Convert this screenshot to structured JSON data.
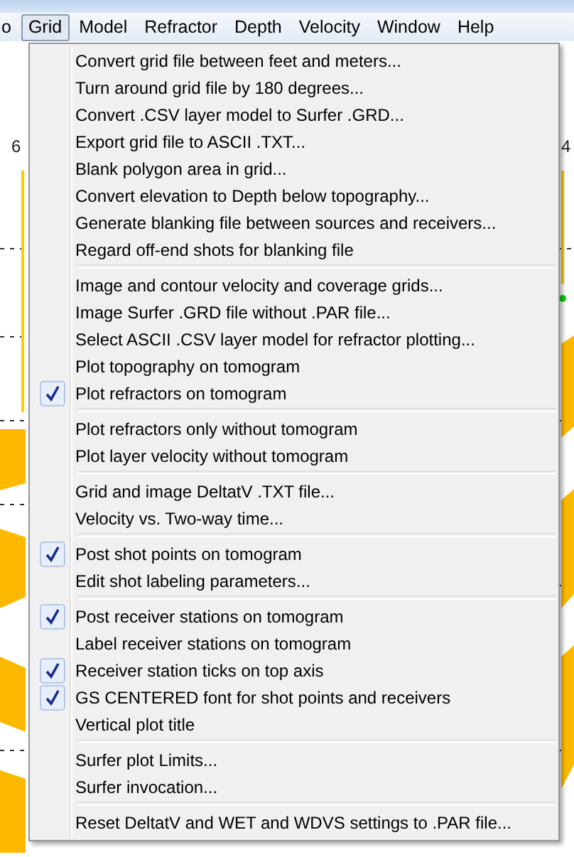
{
  "menubar": [
    {
      "label": "o",
      "selected": false
    },
    {
      "label": "Grid",
      "selected": true
    },
    {
      "label": "Model",
      "selected": false
    },
    {
      "label": "Refractor",
      "selected": false
    },
    {
      "label": "Depth",
      "selected": false
    },
    {
      "label": "Velocity",
      "selected": false
    },
    {
      "label": "Window",
      "selected": false
    },
    {
      "label": "Help",
      "selected": false
    }
  ],
  "plot": {
    "axis_labels": [
      "6",
      "4"
    ]
  },
  "menu": {
    "groups": [
      [
        {
          "label": "Convert grid file between feet and meters...",
          "checked": false
        },
        {
          "label": "Turn around grid file by 180 degrees...",
          "checked": false
        },
        {
          "label": "Convert .CSV layer model to Surfer .GRD...",
          "checked": false
        },
        {
          "label": "Export grid file to ASCII .TXT...",
          "checked": false
        },
        {
          "label": "Blank polygon area in grid...",
          "checked": false
        },
        {
          "label": "Convert elevation to Depth below topography...",
          "checked": false
        },
        {
          "label": "Generate blanking file between sources and receivers...",
          "checked": false
        },
        {
          "label": "Regard off-end shots for blanking file",
          "checked": false
        }
      ],
      [
        {
          "label": "Image and contour velocity and coverage grids...",
          "checked": false
        },
        {
          "label": "Image Surfer .GRD file without .PAR file...",
          "checked": false
        },
        {
          "label": "Select ASCII .CSV layer model for refractor plotting...",
          "checked": false
        },
        {
          "label": "Plot topography on tomogram",
          "checked": false
        },
        {
          "label": "Plot refractors on tomogram",
          "checked": true
        }
      ],
      [
        {
          "label": "Plot refractors only without tomogram",
          "checked": false
        },
        {
          "label": "Plot layer velocity without tomogram",
          "checked": false
        }
      ],
      [
        {
          "label": "Grid and image DeltatV .TXT file...",
          "checked": false
        },
        {
          "label": "Velocity vs. Two-way time...",
          "checked": false
        }
      ],
      [
        {
          "label": "Post shot points on tomogram",
          "checked": true
        },
        {
          "label": "Edit shot labeling parameters...",
          "checked": false
        }
      ],
      [
        {
          "label": "Post receiver stations on tomogram",
          "checked": true
        },
        {
          "label": "Label receiver stations on tomogram",
          "checked": false
        },
        {
          "label": "Receiver station ticks on top axis",
          "checked": true
        },
        {
          "label": "GS CENTERED font for shot points and receivers",
          "checked": true
        },
        {
          "label": "Vertical plot title",
          "checked": false
        }
      ],
      [
        {
          "label": "Surfer plot Limits...",
          "checked": false
        },
        {
          "label": "Surfer invocation...",
          "checked": false
        }
      ],
      [
        {
          "label": "Reset DeltatV and WET and WDVS settings to .PAR file...",
          "checked": false
        }
      ]
    ]
  }
}
